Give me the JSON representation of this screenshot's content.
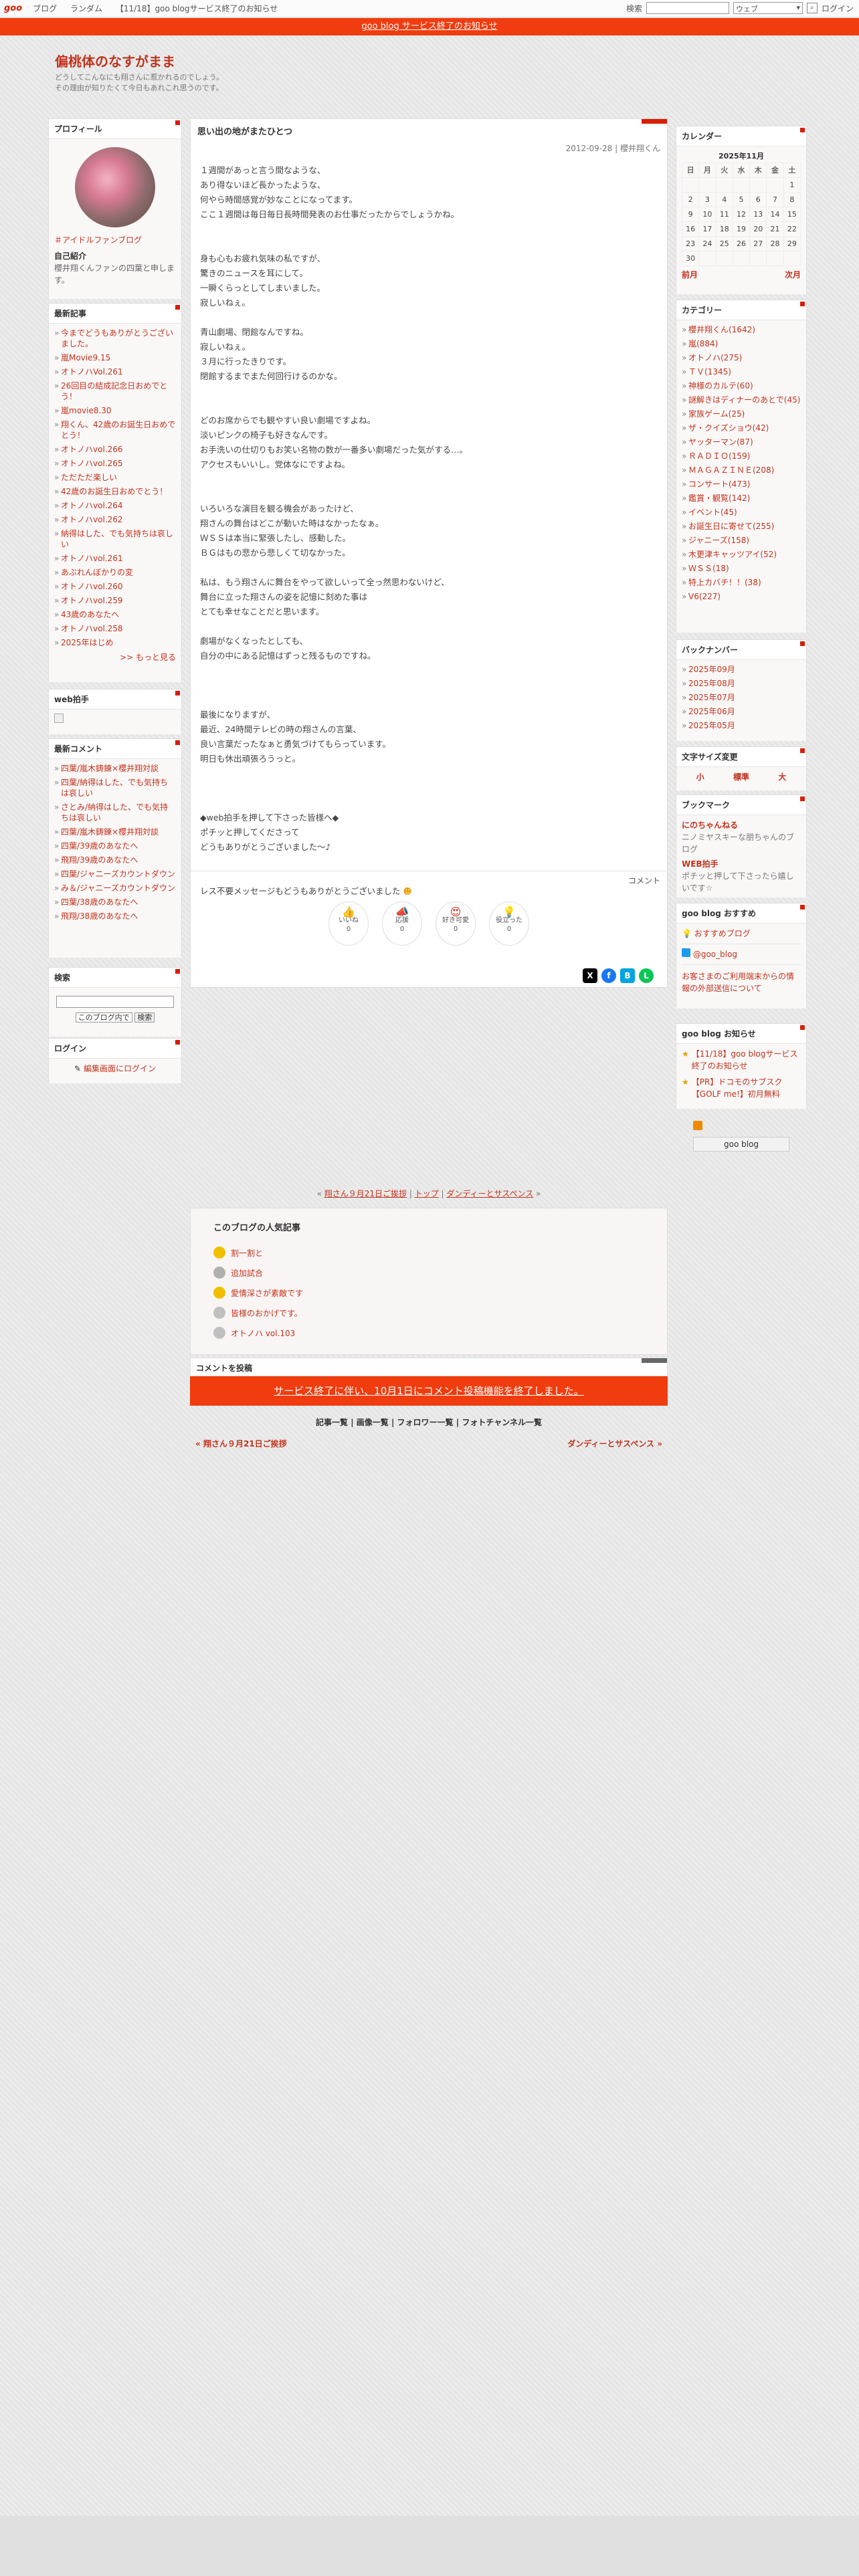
{
  "topbar": {
    "logo": "goo",
    "nav": [
      "ブログ",
      "ランダム",
      "【11/18】goo blogサービス終了のお知らせ"
    ],
    "search_label": "検索",
    "search_select": "ウェブ",
    "login": "ログイン"
  },
  "notice": "goo blog サービス終了のお知らせ",
  "blog": {
    "title": "偏桃体のなすがまま",
    "desc": "どうしてこんなにも翔さんに惹かれるのでしょう。\nその理由が知りたくて今日もあれこれ思うのです。"
  },
  "profile": {
    "heading": "プロフィール",
    "link": "＃アイドルファンブログ",
    "intro_label": "自己紹介",
    "intro": "櫻井翔くんファンの四葉と申します。"
  },
  "recent": {
    "heading": "最新記事",
    "items": [
      "今までどうもありがとうございました。",
      "嵐Movie9.15",
      "オトノハVol.261",
      "26回目の結成記念日おめでとう！",
      "嵐movie8.30",
      "翔くん、42歳のお誕生日おめでとう！",
      "オトノハvol.266",
      "オトノハvol.265",
      "ただただ楽しい",
      "42歳のお誕生日おめでとう！",
      "オトノハvol.264",
      "オトノハvol.262",
      "納得はした、でも気持ちは哀しい",
      "オトノハvol.261",
      "あぶれんぼかりの変",
      "オトノハvol.260",
      "オトノハvol.259",
      "43歳のあなたへ",
      "オトノハvol.258",
      "2025年はじめ"
    ],
    "more": ">> もっと見る"
  },
  "webclap": {
    "heading": "web拍手"
  },
  "comments": {
    "heading": "最新コメント",
    "items": [
      "四葉/嵐木鋳錬×櫻井翔対談",
      "四葉/納得はした、でも気持ちは哀しい",
      "さとみ/納得はした、でも気持ちは哀しい",
      "四葉/嵐木鋳錬×櫻井翔対談",
      "四葉/39歳のあなたへ",
      "飛翔/39歳のあなたへ",
      "四葉/ジャニーズカウントダウン",
      "み＆/ジャニーズカウントダウン",
      "四葉/38歳のあなたへ",
      "飛翔/38歳のあなたへ"
    ]
  },
  "search": {
    "heading": "検索",
    "scope": "このブログ内で",
    "button": "検索"
  },
  "login": {
    "heading": "ログイン",
    "link": "編集画面にログイン"
  },
  "article": {
    "title": "思い出の地がまたひとつ",
    "date": "2012-09-28 | 櫻井翔くん",
    "body": "１週間があっと言う間なような、\nあり得ないほど長かったような、\n何やら時間感覚が妙なことになってます。\nここ１週間は毎日毎日長時間発表のお仕事だったからでしょうかね。\n\n\n身も心もお疲れ気味の私ですが、\n驚きのニュースを耳にして。\n一瞬くらっとしてしまいました。\n寂しいねぇ。\n\n青山劇場、閉館なんですね。\n寂しいねぇ。\n３月に行ったきりです。\n閉館するまでまた何回行けるのかな。\n\n\nどのお席からでも観やすい良い劇場ですよね。\n淡いピンクの椅子も好きなんです。\nお手洗いの仕切りもお笑い名物の数が一番多い劇場だった気がする…。\nアクセスもいいし。党体なにですよね。\n\n\nいろいろな演目を観る機会があったけど、\n翔さんの舞台はどこが動いた時はなかったなぁ。\nＷＳＳは本当に緊張したし、感動した。\nＢＧはもの悲から悲しくて切なかった。\n\n私は、もう翔さんに舞台をやって欲しいって全っ然思わないけど、\n舞台に立った翔さんの姿を記憶に刻めた事は\nとても幸せなことだと思います。\n\n劇場がなくなったとしても、\n自分の中にある記憶はずっと残るものですね。\n\n\n\n最後になりますが、\n最近、24時間テレビの時の翔さんの言葉、\n良い言葉だったなぁと勇気づけてもらっています。\n明日も休出頑張ろうっと。\n\n\n\n◆web拍手を押して下さった皆様へ◆\nポチッと押してくださって\nどうもありがとうございました〜♪\n\n\nレス不要メッセージもどうもありがとうございました",
    "comment_label": "コメント",
    "reactions": [
      {
        "label": "いいね",
        "count": "0"
      },
      {
        "label": "応援",
        "count": "0"
      },
      {
        "label": "好き可愛",
        "count": "0"
      },
      {
        "label": "役立った",
        "count": "0"
      }
    ]
  },
  "calendar": {
    "heading": "カレンダー",
    "month": "2025年11月",
    "weekdays": [
      "日",
      "月",
      "火",
      "水",
      "木",
      "金",
      "土"
    ],
    "weeks": [
      [
        "",
        "",
        "",
        "",
        "",
        "",
        "1"
      ],
      [
        "2",
        "3",
        "4",
        "5",
        "6",
        "7",
        "8"
      ],
      [
        "9",
        "10",
        "11",
        "12",
        "13",
        "14",
        "15"
      ],
      [
        "16",
        "17",
        "18",
        "19",
        "20",
        "21",
        "22"
      ],
      [
        "23",
        "24",
        "25",
        "26",
        "27",
        "28",
        "29"
      ],
      [
        "30",
        "",
        "",
        "",
        "",
        "",
        ""
      ]
    ],
    "prev": "前月",
    "next": "次月"
  },
  "categories": {
    "heading": "カテゴリー",
    "items": [
      "櫻井翔くん(1642)",
      "嵐(884)",
      "オトノハ(275)",
      "ＴＶ(1345)",
      "神様のカルテ(60)",
      "謎解きはディナーのあとで(45)",
      "家族ゲーム(25)",
      "ザ・クイズショウ(42)",
      "ヤッターマン(87)",
      "ＲＡＤＩＯ(159)",
      "ＭＡＧＡＺＩＮＥ(208)",
      "コンサート(473)",
      "鑑賞・観覧(142)",
      "イベント(45)",
      "お誕生日に寄せて(255)",
      "ジャニーズ(158)",
      "木更津キャッツアイ(52)",
      "ＷＳＳ(18)",
      "特上カバチ！！(38)",
      "V6(227)"
    ]
  },
  "backnumber": {
    "heading": "バックナンバー",
    "items": [
      "2025年09月",
      "2025年08月",
      "2025年07月",
      "2025年06月",
      "2025年05月"
    ]
  },
  "fontsize": {
    "heading": "文字サイズ変更",
    "small": "小",
    "normal": "標準",
    "large": "大"
  },
  "bookmark": {
    "heading": "ブックマーク",
    "items": [
      {
        "title": "にのちゃんねる",
        "desc": "ニノミヤスキーな朋ちゃんのブログ"
      },
      {
        "title": "WEB拍手",
        "desc": "ポチッと押して下さったら嬉しいです☆"
      }
    ]
  },
  "recommend": {
    "heading": "goo blog おすすめ",
    "items": [
      "おすすめブログ",
      "@goo_blog"
    ],
    "note": "お客さまのご利用端末からの情報の外部送信について"
  },
  "news": {
    "heading": "goo blog お知らせ",
    "items": [
      "【11/18】goo blogサービス終了のお知らせ",
      "【PR】ドコモのサブスク【GOLF me!】初月無料"
    ]
  },
  "rss_badge": "goo blog",
  "post_nav": {
    "prev": "翔さん９月21日ご挨拶",
    "top": "トップ",
    "next": "ダンディーとサスペンス"
  },
  "popular": {
    "heading": "このブログの人気記事",
    "items": [
      "割一割と",
      "追加試合",
      "愛情深さが素敵です",
      "皆様のおかげです。",
      "オトノハ vol.103"
    ]
  },
  "comment_post": {
    "heading": "コメントを投稿",
    "closed": "サービス終了に伴い、10月1日にコメント投稿機能を終了しました。"
  },
  "bottom_links": [
    "記事一覧",
    "画像一覧",
    "フォロワー一覧",
    "フォトチャンネル一覧"
  ],
  "colors": {
    "accent": "#d81e05",
    "notice_bg": "#f03c0e",
    "link": "#c0341d"
  }
}
